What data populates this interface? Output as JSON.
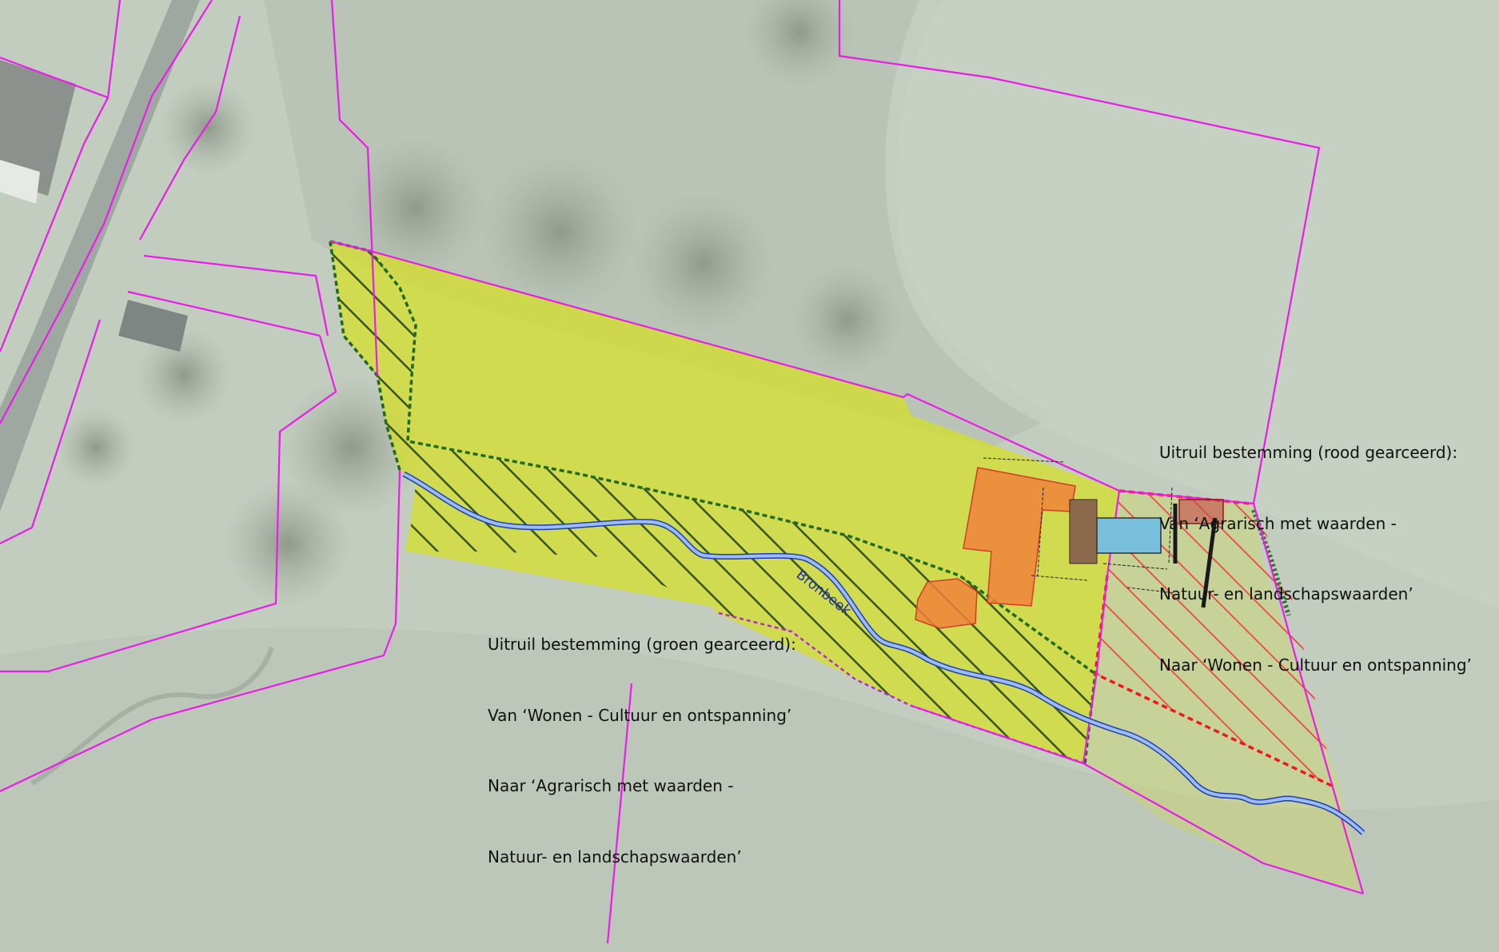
{
  "stream": {
    "name": "Bronbeek"
  },
  "annotation_green": {
    "lines": [
      "Uitruil bestemming (groen gearceerd):",
      "Van ‘Wonen - Cultuur en ontspanning’",
      "Naar ‘Agrarisch met waarden -",
      "Natuur- en landschapswaarden’"
    ]
  },
  "annotation_red": {
    "lines": [
      "Uitruil bestemming (rood gearceerd):",
      "Van ‘Agrarisch met waarden -",
      "Natuur- en landschapswaarden’",
      "Naar ‘Wonen - Cultuur en ontspanning’"
    ]
  },
  "colors": {
    "background_field": "#b9c3b6",
    "parcel_boundary": "#e81ee8",
    "zone_wonen_fill": "#d6e11e",
    "hatch_green": "#1f6b1a",
    "hatch_red": "#f0373a",
    "building_fill": "#f08238",
    "stream": "#7ea0e8"
  }
}
